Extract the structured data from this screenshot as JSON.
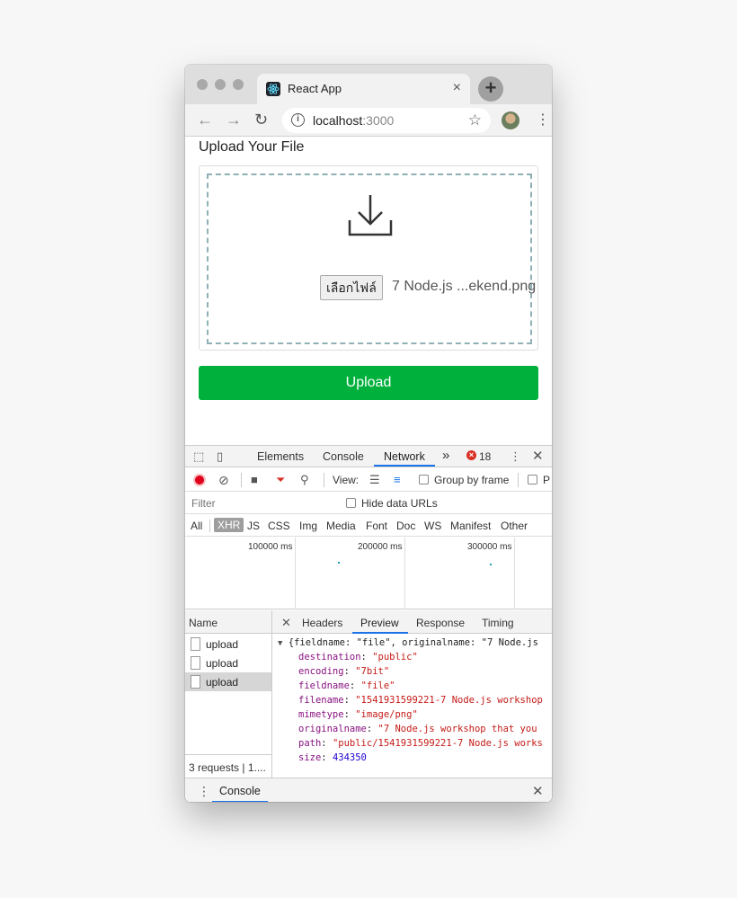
{
  "browser": {
    "tab_title": "React App",
    "new_tab_label": "+",
    "url_host": "localhost",
    "url_port": ":3000"
  },
  "page": {
    "heading": "Upload Your File",
    "choose_file_label": "เลือกไฟล์",
    "chosen_file_name": "7 Node.js ...ekend.png",
    "upload_button_label": "Upload"
  },
  "devtools": {
    "tabs": [
      "Elements",
      "Console",
      "Network"
    ],
    "active_tab": "Network",
    "more_label": "»",
    "error_count": "18",
    "toolbar": {
      "view_label": "View:",
      "group_by_frame_label": "Group by frame",
      "truncated_label": "P"
    },
    "filter": {
      "placeholder": "Filter",
      "hide_data_urls_label": "Hide data URLs"
    },
    "types": [
      "All",
      "XHR",
      "JS",
      "CSS",
      "Img",
      "Media",
      "Font",
      "Doc",
      "WS",
      "Manifest",
      "Other"
    ],
    "active_type": "XHR",
    "timeline_labels": [
      "100000 ms",
      "200000 ms",
      "300000 ms"
    ],
    "name_header": "Name",
    "requests": [
      "upload",
      "upload",
      "upload"
    ],
    "selected_request_index": 2,
    "status_text": "3 requests | 1....",
    "detail_tabs": [
      "Headers",
      "Preview",
      "Response",
      "Timing"
    ],
    "active_detail_tab": "Preview",
    "preview": {
      "summary": "{fieldname: \"file\", originalname: \"7 Node.js",
      "fields": [
        {
          "key": "destination",
          "value": "\"public\"",
          "type": "string"
        },
        {
          "key": "encoding",
          "value": "\"7bit\"",
          "type": "string"
        },
        {
          "key": "fieldname",
          "value": "\"file\"",
          "type": "string"
        },
        {
          "key": "filename",
          "value": "\"1541931599221-7 Node.js workshop",
          "type": "string"
        },
        {
          "key": "mimetype",
          "value": "\"image/png\"",
          "type": "string"
        },
        {
          "key": "originalname",
          "value": "\"7 Node.js workshop that you",
          "type": "string"
        },
        {
          "key": "path",
          "value": "\"public/1541931599221-7 Node.js works",
          "type": "string"
        },
        {
          "key": "size",
          "value": "434350",
          "type": "number"
        }
      ]
    },
    "drawer_tab": "Console"
  },
  "colors": {
    "upload_button": "#00b03c",
    "record": "#e0001b",
    "accent_underline": "#1a73e8",
    "dashed_border": "#8fb0b6"
  }
}
